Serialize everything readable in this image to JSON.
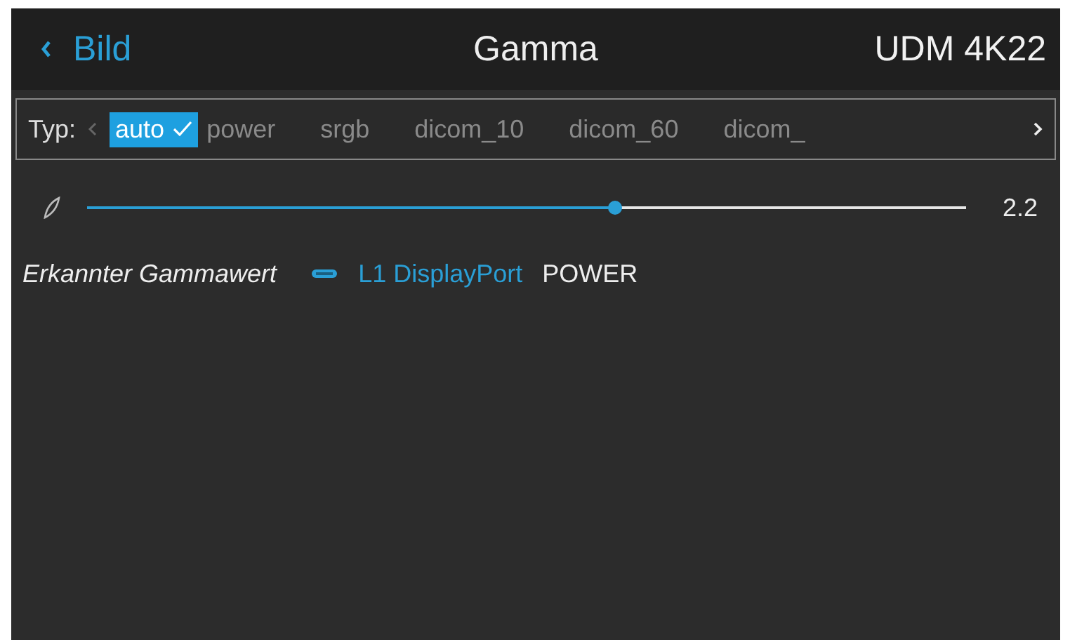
{
  "header": {
    "back_label": "Bild",
    "title": "Gamma",
    "device": "UDM 4K22"
  },
  "type_selector": {
    "label": "Typ:",
    "options": [
      {
        "label": "auto",
        "selected": true
      },
      {
        "label": "power",
        "selected": false
      },
      {
        "label": "srgb",
        "selected": false
      },
      {
        "label": "dicom_10",
        "selected": false
      },
      {
        "label": "dicom_60",
        "selected": false
      },
      {
        "label": "dicom_",
        "selected": false
      }
    ]
  },
  "slider": {
    "level": 0.6,
    "reading": "2.2"
  },
  "detected": {
    "label": "Erkannter Gammawert",
    "source": "L1 DisplayPort",
    "value": "POWER"
  }
}
